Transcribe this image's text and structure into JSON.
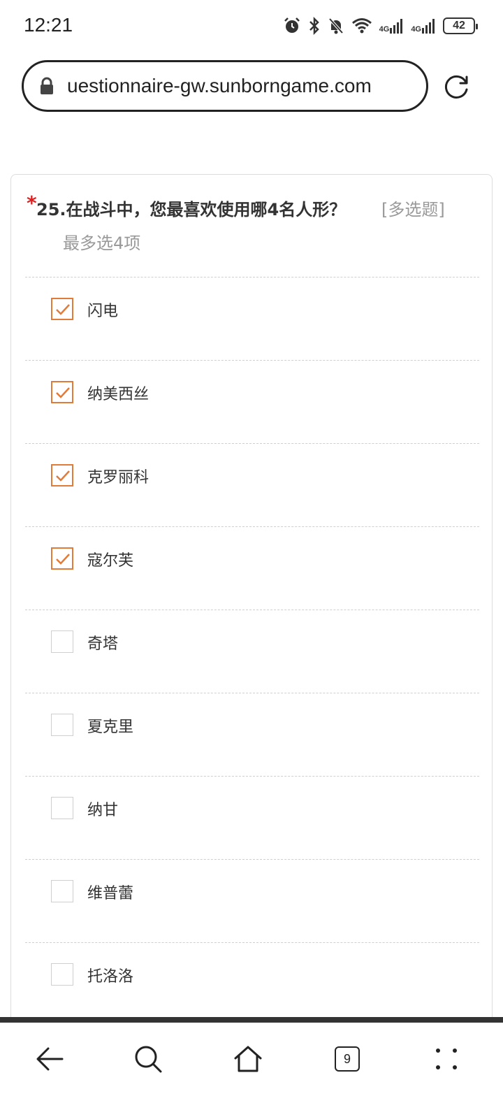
{
  "status_bar": {
    "time": "12:21",
    "network_1": "4G",
    "network_2": "4G",
    "battery": "42",
    "icons": [
      "alarm-icon",
      "bluetooth-icon",
      "notifications-off-icon",
      "wifi-icon",
      "signal-icon",
      "signal-icon",
      "battery-icon"
    ]
  },
  "browser": {
    "url": "uestionnaire-gw.sunborngame.com",
    "icons": [
      "lock-icon",
      "reload-icon"
    ]
  },
  "question": {
    "required_mark": "*",
    "text": "25.在战斗中，您最喜欢使用哪4名人形？",
    "type": "[多选题]",
    "hint": "最多选4项",
    "options": [
      {
        "label": "闪电",
        "checked": true
      },
      {
        "label": "纳美西丝",
        "checked": true
      },
      {
        "label": "克罗丽科",
        "checked": true
      },
      {
        "label": "寇尔芙",
        "checked": true
      },
      {
        "label": "奇塔",
        "checked": false
      },
      {
        "label": "夏克里",
        "checked": false
      },
      {
        "label": "纳甘",
        "checked": false
      },
      {
        "label": "维普蕾",
        "checked": false
      },
      {
        "label": "托洛洛",
        "checked": false
      }
    ]
  },
  "bottom_nav": {
    "tabs_count": "9",
    "icons": [
      "back-arrow-icon",
      "search-icon",
      "home-icon",
      "tabs-icon",
      "more-icon"
    ]
  },
  "colors": {
    "accent": "#e07b39",
    "required": "#e02020",
    "muted_text": "#999999",
    "text": "#333333"
  }
}
